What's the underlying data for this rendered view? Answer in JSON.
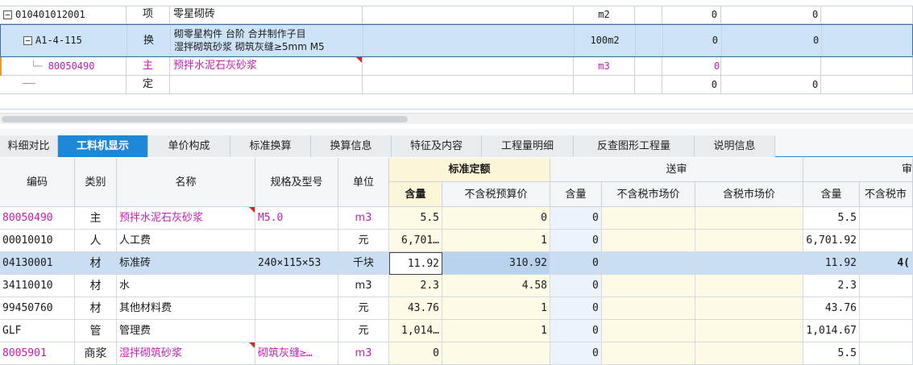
{
  "upper_grid": {
    "cut_header_text": "",
    "rows": [
      {
        "code": "010401012001",
        "type": "项",
        "name": "零星砌砖",
        "unit": "m2",
        "qty": "0",
        "val": "0",
        "expand": "−"
      },
      {
        "code": "A1-4-115",
        "type": "换",
        "name_line1": "砌零星构件 台阶  合并制作子目",
        "name_line2": "湿拌砌筑砂浆 砌筑灰缝≥5mm M5",
        "unit": "100m2",
        "qty": "0",
        "val": "0",
        "expand": "−"
      },
      {
        "code": "80050490",
        "type": "主",
        "name": "预拌水泥石灰砂浆",
        "unit": "m3",
        "qty": "0",
        "val": ""
      },
      {
        "code": "",
        "type": "定",
        "name": "",
        "unit": "",
        "qty": "0",
        "val": "0"
      }
    ]
  },
  "tabs": [
    "料细对比",
    "工料机显示",
    "单价构成",
    "标准换算",
    "换算信息",
    "特征及内容",
    "工程量明细",
    "反查图形工程量",
    "说明信息"
  ],
  "active_tab": 1,
  "lower_grid": {
    "headers": {
      "code": "编码",
      "type": "类别",
      "name": "名称",
      "spec": "规格及型号",
      "unit": "单位",
      "group_standard": "标准定额",
      "group_review": "送审",
      "group_next": "审",
      "qty": "含量",
      "tax_excl_budget": "不含税预算价",
      "review_qty": "含量",
      "tax_excl_market": "不含税市场价",
      "tax_incl_market": "含税市场价",
      "next_qty": "含量",
      "next_tax_excl": "不含税市"
    },
    "rows": [
      {
        "code": "80050490",
        "type": "主",
        "name": "预拌水泥石灰砂浆",
        "spec": "M5.0",
        "unit": "m3",
        "qty": "5.5",
        "price": "0",
        "rqty": "0",
        "m1": "",
        "m2": "",
        "nqty": "5.5",
        "nprice": "",
        "pink": true
      },
      {
        "code": "00010010",
        "type": "人",
        "name": "人工费",
        "spec": "",
        "unit": "元",
        "qty": "6,701…",
        "price": "1",
        "rqty": "0",
        "m1": "",
        "m2": "",
        "nqty": "6,701.92",
        "nprice": ""
      },
      {
        "code": "04130001",
        "type": "材",
        "name": "标准砖",
        "spec": "240×115×53",
        "unit": "千块",
        "qty": "11.92",
        "price": "310.92",
        "rqty": "0",
        "m1": "",
        "m2": "",
        "nqty": "11.92",
        "nprice": "4(",
        "selected": true
      },
      {
        "code": "34110010",
        "type": "材",
        "name": "水",
        "spec": "",
        "unit": "m3",
        "qty": "2.3",
        "price": "4.58",
        "rqty": "0",
        "m1": "",
        "m2": "",
        "nqty": "2.3",
        "nprice": ""
      },
      {
        "code": "99450760",
        "type": "材",
        "name": "其他材料费",
        "spec": "",
        "unit": "元",
        "qty": "43.76",
        "price": "1",
        "rqty": "0",
        "m1": "",
        "m2": "",
        "nqty": "43.76",
        "nprice": ""
      },
      {
        "code": "GLF",
        "type": "管",
        "name": "管理费",
        "spec": "",
        "unit": "元",
        "qty": "1,014…",
        "price": "1",
        "rqty": "0",
        "m1": "",
        "m2": "",
        "nqty": "1,014.67",
        "nprice": ""
      },
      {
        "code": "8005901",
        "type": "商浆",
        "name": "湿拌砌筑砂浆",
        "spec": "砌筑灰缝≥…",
        "unit": "m3",
        "qty": "0",
        "price": "",
        "rqty": "0",
        "m1": "",
        "m2": "",
        "nqty": "5.5",
        "nprice": "",
        "pink": true
      }
    ]
  }
}
